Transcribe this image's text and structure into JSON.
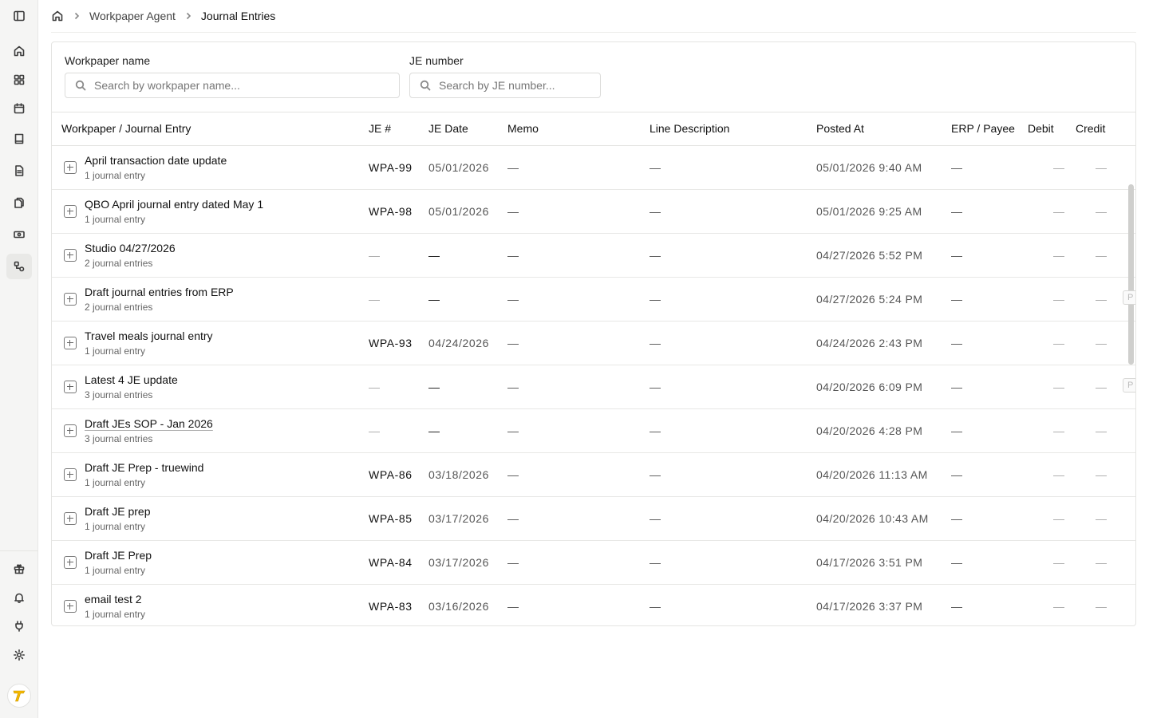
{
  "breadcrumb": {
    "parent": "Workpaper Agent",
    "current": "Journal Entries"
  },
  "filters": {
    "workpaper": {
      "label": "Workpaper name",
      "placeholder": "Search by workpaper name..."
    },
    "je": {
      "label": "JE number",
      "placeholder": "Search by JE number..."
    }
  },
  "columns": {
    "name": "Workpaper / Journal Entry",
    "je_num": "JE #",
    "je_date": "JE Date",
    "memo": "Memo",
    "line_desc": "Line Description",
    "posted_at": "Posted At",
    "erp_payee": "ERP / Payee",
    "debit": "Debit",
    "credit": "Credit"
  },
  "rows": [
    {
      "title": "April transaction date update",
      "sub": "1 journal entry",
      "je_num": "WPA-99",
      "je_date": "05/01/2026",
      "memo": "—",
      "line_desc": "—",
      "posted_at": "05/01/2026 9:40 AM",
      "erp": "—",
      "debit": "—",
      "credit": "—"
    },
    {
      "title": "QBO April journal entry dated May 1",
      "sub": "1 journal entry",
      "je_num": "WPA-98",
      "je_date": "05/01/2026",
      "memo": "—",
      "line_desc": "—",
      "posted_at": "05/01/2026 9:25 AM",
      "erp": "—",
      "debit": "—",
      "credit": "—"
    },
    {
      "title": "Studio 04/27/2026",
      "sub": "2 journal entries",
      "je_num": "—",
      "je_date": "—",
      "memo": "—",
      "line_desc": "—",
      "posted_at": "04/27/2026 5:52 PM",
      "erp": "—",
      "debit": "—",
      "credit": "—"
    },
    {
      "title": "Draft journal entries from ERP",
      "sub": "2 journal entries",
      "je_num": "—",
      "je_date": "—",
      "memo": "—",
      "line_desc": "—",
      "posted_at": "04/27/2026 5:24 PM",
      "erp": "—",
      "debit": "—",
      "credit": "—"
    },
    {
      "title": "Travel meals journal entry",
      "sub": "1 journal entry",
      "je_num": "WPA-93",
      "je_date": "04/24/2026",
      "memo": "—",
      "line_desc": "—",
      "posted_at": "04/24/2026 2:43 PM",
      "erp": "—",
      "debit": "—",
      "credit": "—"
    },
    {
      "title": "Latest 4 JE update",
      "sub": "3 journal entries",
      "je_num": "—",
      "je_date": "—",
      "memo": "—",
      "line_desc": "—",
      "posted_at": "04/20/2026 6:09 PM",
      "erp": "—",
      "debit": "—",
      "credit": "—"
    },
    {
      "title": "Draft JEs SOP - Jan 2026",
      "sub": "3 journal entries",
      "je_num": "—",
      "je_date": "—",
      "memo": "—",
      "line_desc": "—",
      "posted_at": "04/20/2026 4:28 PM",
      "erp": "—",
      "debit": "—",
      "credit": "—"
    },
    {
      "title": "Draft JE Prep - truewind",
      "sub": "1 journal entry",
      "je_num": "WPA-86",
      "je_date": "03/18/2026",
      "memo": "—",
      "line_desc": "—",
      "posted_at": "04/20/2026 11:13 AM",
      "erp": "—",
      "debit": "—",
      "credit": "—"
    },
    {
      "title": "Draft JE prep",
      "sub": "1 journal entry",
      "je_num": "WPA-85",
      "je_date": "03/17/2026",
      "memo": "—",
      "line_desc": "—",
      "posted_at": "04/20/2026 10:43 AM",
      "erp": "—",
      "debit": "—",
      "credit": "—"
    },
    {
      "title": "Draft JE Prep",
      "sub": "1 journal entry",
      "je_num": "WPA-84",
      "je_date": "03/17/2026",
      "memo": "—",
      "line_desc": "—",
      "posted_at": "04/17/2026 3:51 PM",
      "erp": "—",
      "debit": "—",
      "credit": "—"
    },
    {
      "title": "email test 2",
      "sub": "1 journal entry",
      "je_num": "WPA-83",
      "je_date": "03/16/2026",
      "memo": "—",
      "line_desc": "—",
      "posted_at": "04/17/2026 3:37 PM",
      "erp": "—",
      "debit": "—",
      "credit": "—"
    }
  ],
  "edge_badges": [
    "P",
    "P"
  ],
  "theme": {
    "accent": "#f5b800",
    "border": "#e4e4e2",
    "sidebar_bg": "#f5f5f4"
  }
}
